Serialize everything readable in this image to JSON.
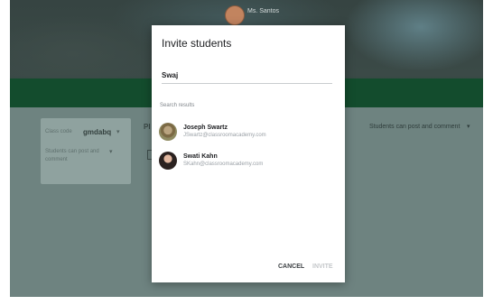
{
  "class_page": {
    "teacher_name": "Ms. Santos",
    "class_code_label": "Class code",
    "class_code_value": "gmdabq",
    "card_permission": "Students can post and comment",
    "stream_label": "Pl",
    "post_permission": "Students can post and comment",
    "caret": "▾"
  },
  "dialog": {
    "title": "Invite students",
    "search_value": "Swaj",
    "results_label": "Search results",
    "results": [
      {
        "name": "Joseph Swartz",
        "email": "JSwartz@classroomacademy.com"
      },
      {
        "name": "Swati Kahn",
        "email": "SKahn@classroomacademy.com"
      }
    ],
    "cancel_label": "CANCEL",
    "invite_label": "INVITE"
  }
}
